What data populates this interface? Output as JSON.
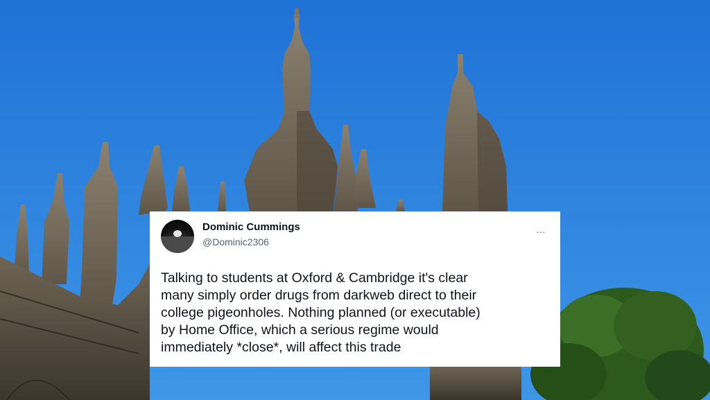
{
  "tweet": {
    "display_name": "Dominic Cummings",
    "handle": "@Dominic2306",
    "text_lines": [
      "Talking to students at Oxford & Cambridge it's clear",
      "many simply order drugs from darkweb direct to their",
      "college pigeonholes. Nothing planned (or executable)",
      "by Home Office, which a serious regime would",
      "immediately *close*, will affect this trade"
    ],
    "more_icon": "…",
    "avatar_icon": "moon-horizon-avatar"
  },
  "background": {
    "subject": "gothic-college-chapel-spires",
    "colors": {
      "sky": "#2f84de",
      "stone": "#9a8f79",
      "tree": "#2c5a1c"
    }
  }
}
